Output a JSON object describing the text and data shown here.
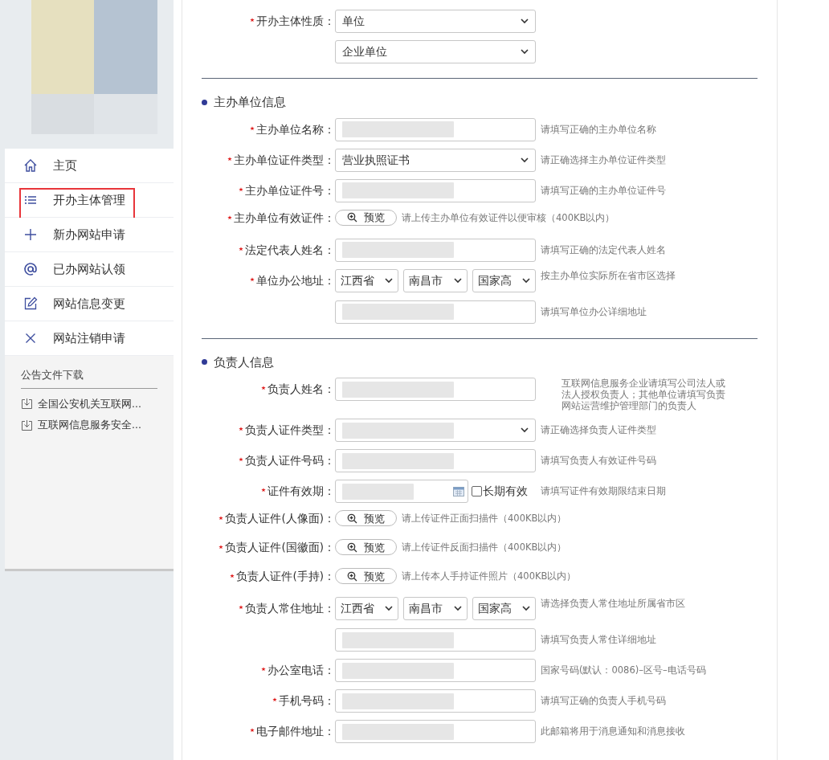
{
  "sidebar": {
    "menu": [
      {
        "label": "主页",
        "highlighted": false
      },
      {
        "label": "开办主体管理",
        "highlighted": true
      },
      {
        "label": "新办网站申请",
        "highlighted": false
      },
      {
        "label": "已办网站认领",
        "highlighted": false
      },
      {
        "label": "网站信息变更",
        "highlighted": false
      },
      {
        "label": "网站注销申请",
        "highlighted": false
      }
    ],
    "notices": {
      "title": "公告文件下载",
      "items": [
        "全国公安机关互联网...",
        "互联网信息服务安全..."
      ]
    }
  },
  "form": {
    "top_rows": [
      {
        "kind": "select",
        "label": "开办主体性质：",
        "required": true,
        "value": "单位"
      },
      {
        "kind": "select",
        "value": "企业单位"
      }
    ],
    "sections": [
      {
        "title": "主办单位信息",
        "rows": [
          {
            "kind": "text",
            "label": "主办单位名称：",
            "required": true,
            "redacted": true,
            "hint": "请填写正确的主办单位名称"
          },
          {
            "kind": "select",
            "label": "主办单位证件类型：",
            "required": true,
            "value": "营业执照证书",
            "hint": "请正确选择主办单位证件类型"
          },
          {
            "kind": "text",
            "label": "主办单位证件号：",
            "required": true,
            "redacted": true,
            "hint": "请填写正确的主办单位证件号"
          },
          {
            "kind": "upload",
            "label": "主办单位有效证件：",
            "required": true,
            "button": "预览",
            "hint": "请上传主办单位有效证件以便审核（400KB以内）"
          },
          {
            "kind": "text",
            "label": "法定代表人姓名：",
            "required": true,
            "redacted": true,
            "hint": "请填写正确的法定代表人姓名"
          },
          {
            "kind": "address",
            "label": "单位办公地址：",
            "required": true,
            "values": [
              "江西省",
              "南昌市",
              "国家高"
            ],
            "hint": "按主办单位实际所在省市区选择"
          },
          {
            "kind": "text",
            "redacted": true,
            "hint": "请填写单位办公详细地址"
          }
        ]
      },
      {
        "title": "负责人信息",
        "rows": [
          {
            "kind": "text",
            "label": "负责人姓名：",
            "required": true,
            "redacted": true,
            "hint": "互联网信息服务企业请填写公司法人或法人授权负责人；其他单位请填写负责网站运营维护管理部门的负责人"
          },
          {
            "kind": "select",
            "label": "负责人证件类型：",
            "required": true,
            "redacted": true,
            "hint": "请正确选择负责人证件类型"
          },
          {
            "kind": "text",
            "label": "负责人证件号码：",
            "required": true,
            "redacted": true,
            "hint": "请填写负责人有效证件号码"
          },
          {
            "kind": "date",
            "label": "证件有效期：",
            "required": true,
            "redacted": true,
            "checkbox": {
              "label": "长期有效",
              "checked": false
            },
            "hint": "请填写证件有效期限结束日期"
          },
          {
            "kind": "upload",
            "label": "负责人证件(人像面)：",
            "required": true,
            "button": "预览",
            "hint": "请上传证件正面扫描件（400KB以内）"
          },
          {
            "kind": "upload",
            "label": "负责人证件(国徽面)：",
            "required": true,
            "button": "预览",
            "hint": "请上传证件反面扫描件（400KB以内）"
          },
          {
            "kind": "upload",
            "label": "负责人证件(手持)：",
            "required": true,
            "button": "预览",
            "hint": "请上传本人手持证件照片（400KB以内）"
          },
          {
            "kind": "address",
            "label": "负责人常住地址：",
            "required": true,
            "values": [
              "江西省",
              "南昌市",
              "国家高"
            ],
            "hint": "请选择负责人常住地址所属省市区"
          },
          {
            "kind": "text",
            "redacted": true,
            "hint": "请填写负责人常住详细地址"
          },
          {
            "kind": "text",
            "label": "办公室电话：",
            "required": true,
            "redacted": true,
            "hint": "国家号码(默认：0086)–区号–电话号码"
          },
          {
            "kind": "text",
            "label": "手机号码：",
            "required": true,
            "redacted": true,
            "hint": "请填写正确的负责人手机号码"
          },
          {
            "kind": "text",
            "label": "电子邮件地址：",
            "required": true,
            "redacted": true,
            "hint": "此邮箱将用于消息通知和消息接收"
          }
        ]
      }
    ]
  }
}
